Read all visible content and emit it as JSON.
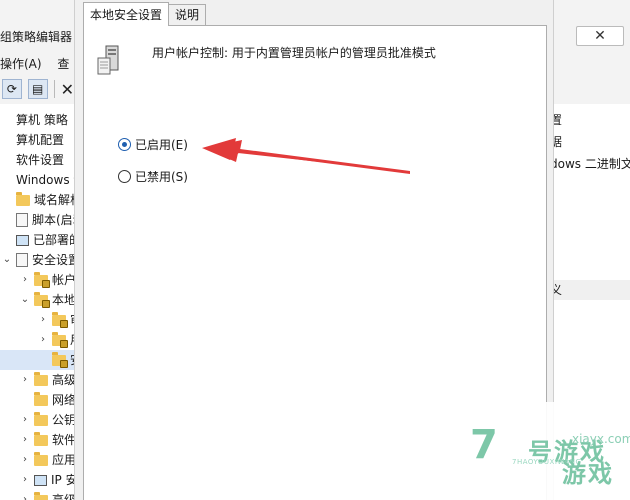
{
  "background_window": {
    "title_fragment": "组策略编辑器",
    "menu": [
      "操作(A)",
      "查"
    ],
    "close_glyph": "✕",
    "tree": [
      {
        "label": "算机 策略",
        "indent": 0,
        "icon": "none",
        "chev": ""
      },
      {
        "label": "算机配置",
        "indent": 0,
        "icon": "none",
        "chev": ""
      },
      {
        "label": "软件设置",
        "indent": 0,
        "icon": "none",
        "chev": ""
      },
      {
        "label": "Windows 设",
        "indent": 0,
        "icon": "none",
        "chev": ""
      },
      {
        "label": "域名解析策",
        "indent": 0,
        "icon": "folder",
        "chev": ""
      },
      {
        "label": "脚本(启动",
        "indent": 0,
        "icon": "sheet",
        "chev": ""
      },
      {
        "label": "已部署的打",
        "indent": 0,
        "icon": "pc",
        "chev": ""
      },
      {
        "label": "安全设置",
        "indent": 0,
        "icon": "sheet",
        "chev": "⌄"
      },
      {
        "label": "帐户策",
        "indent": 1,
        "icon": "folder-lock",
        "chev": "›"
      },
      {
        "label": "本地策",
        "indent": 1,
        "icon": "folder-lock",
        "chev": "⌄"
      },
      {
        "label": "审",
        "indent": 2,
        "icon": "folder-lock",
        "chev": "›"
      },
      {
        "label": "用户",
        "indent": 2,
        "icon": "folder-lock",
        "chev": "›"
      },
      {
        "label": "安全",
        "indent": 2,
        "icon": "folder-lock",
        "chev": "",
        "selected": true
      },
      {
        "label": "高级安",
        "indent": 1,
        "icon": "folder",
        "chev": "›"
      },
      {
        "label": "网络列",
        "indent": 1,
        "icon": "folder",
        "chev": ""
      },
      {
        "label": "公钥策",
        "indent": 1,
        "icon": "folder",
        "chev": "›"
      },
      {
        "label": "软件限",
        "indent": 1,
        "icon": "folder",
        "chev": "›"
      },
      {
        "label": "应用程",
        "indent": 1,
        "icon": "folder",
        "chev": "›"
      },
      {
        "label": "IP 安全",
        "indent": 1,
        "icon": "pc",
        "chev": "›"
      },
      {
        "label": "高级审",
        "indent": 1,
        "icon": "folder",
        "chev": "›"
      }
    ],
    "right_pane": [
      "置",
      "据",
      "dows 二进制文",
      "义"
    ]
  },
  "dialog": {
    "tabs": [
      "本地安全设置",
      "说明"
    ],
    "policy_title": "用户帐户控制: 用于内置管理员帐户的管理员批准模式",
    "enabled_label": "已启用(E)",
    "disabled_label": "已禁用(S)",
    "selected": "enabled"
  },
  "watermark": {
    "number": "7",
    "brand": "号游戏",
    "url": "xiayx.com",
    "pinyin": "7HAOYOUXIWANG",
    "game": "游戏"
  },
  "colors": {
    "accent": "#1f5fb0",
    "arrow": "#e23a3a",
    "watermark": "#7dc7a8"
  }
}
